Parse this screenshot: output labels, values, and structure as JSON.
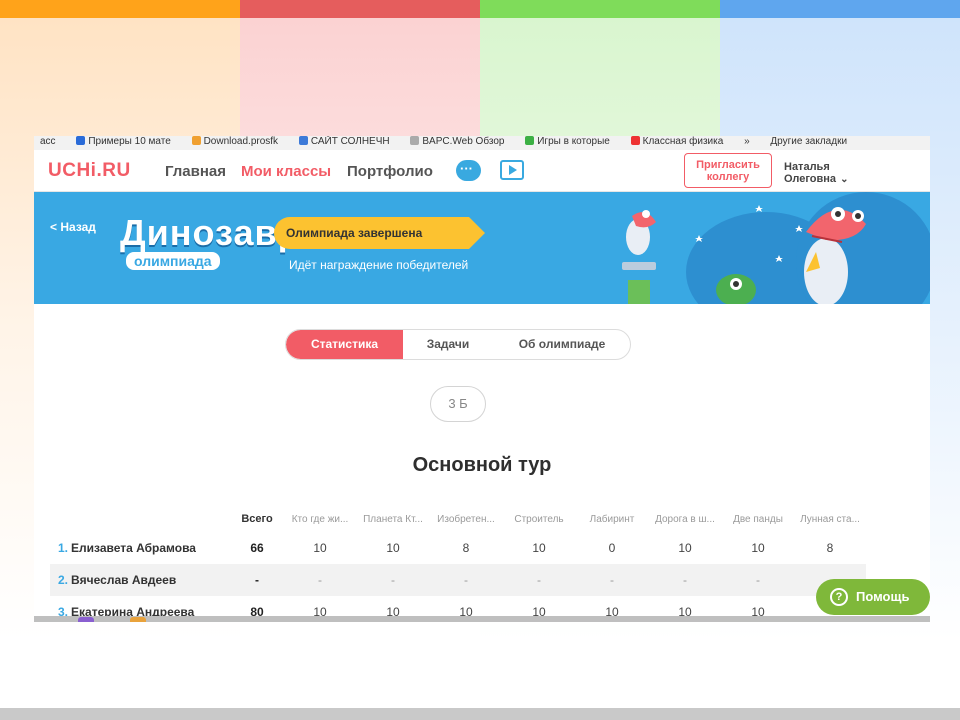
{
  "bookmarks": [
    "асс",
    "Примеры 10 мате",
    "Download.prosfk",
    "САЙТ СОЛНЕЧН",
    "BAPC.Web Обзор",
    "Игры в которые",
    "Классная физика",
    "»",
    "Другие закладки"
  ],
  "nav": {
    "logo": "UCHi.RU",
    "home": "Главная",
    "classes": "Мои классы",
    "portfolio": "Портфолио",
    "invite": "Пригласить коллегу",
    "user_first": "Наталья",
    "user_last": "Олеговна",
    "user_chevron": "⌄"
  },
  "banner": {
    "back": "< Назад",
    "title": "Динозавры",
    "subtitle": "олимпиада",
    "status": "Олимпиада завершена",
    "status_sub": "Идёт награждение победителей"
  },
  "tabs": {
    "stats": "Статистика",
    "tasks": "Задачи",
    "about": "Об олимпиаде"
  },
  "class_label": "3 Б",
  "round_title": "Основной тур",
  "table": {
    "headers": [
      "Всего",
      "Кто где жи...",
      "Планета Кт...",
      "Изобретен...",
      "Строитель",
      "Лабиринт",
      "Дорога в ш...",
      "Две панды",
      "Лунная ста..."
    ],
    "rows": [
      {
        "num": "1.",
        "name": "Елизавета Абрамова",
        "total": "66",
        "scores": [
          "10",
          "10",
          "8",
          "10",
          "0",
          "10",
          "10",
          "8"
        ]
      },
      {
        "num": "2.",
        "name": "Вячеслав Авдеев",
        "total": "-",
        "scores": [
          "-",
          "-",
          "-",
          "-",
          "-",
          "-",
          "-",
          ""
        ]
      },
      {
        "num": "3.",
        "name": "Екатерина Андреева",
        "total": "80",
        "scores": [
          "10",
          "10",
          "10",
          "10",
          "10",
          "10",
          "10",
          ""
        ]
      }
    ]
  },
  "help": "Помощь",
  "help_icon": "?",
  "colors": {
    "brand_red": "#f25c66",
    "banner_blue": "#39a8e3",
    "flag_yellow": "#fcc230",
    "help_green": "#7fb83a",
    "stripe_orange": "#ffa31a",
    "stripe_red": "#e55d5d",
    "stripe_green": "#7fdc5a",
    "stripe_blue": "#5fa6ee"
  }
}
